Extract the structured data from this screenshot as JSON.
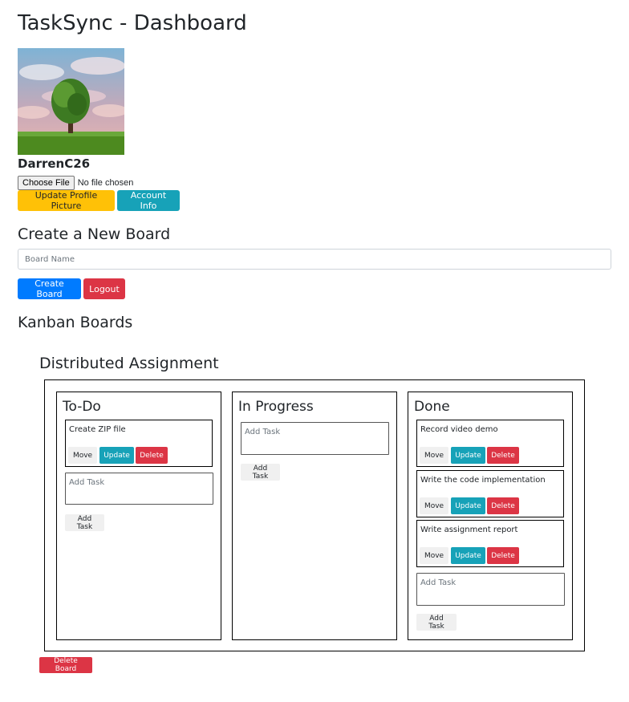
{
  "page_title": "TaskSync - Dashboard",
  "profile": {
    "username": "DarrenC26",
    "choose_file_label": "Choose File",
    "no_file_text": "No file chosen",
    "update_picture_label": "Update Profile Picture",
    "account_info_label": "Account Info"
  },
  "create_board": {
    "heading": "Create a New Board",
    "placeholder": "Board Name",
    "value": "",
    "create_label": "Create Board",
    "logout_label": "Logout"
  },
  "kanban": {
    "heading": "Kanban Boards",
    "board": {
      "title": "Distributed Assignment",
      "delete_label": "Delete Board",
      "columns": [
        {
          "title": "To-Do",
          "tasks": [
            "Create ZIP file"
          ],
          "add_placeholder": "Add Task",
          "add_label": "Add Task"
        },
        {
          "title": "In Progress",
          "tasks": [],
          "add_placeholder": "Add Task",
          "add_label": "Add Task"
        },
        {
          "title": "Done",
          "tasks": [
            "Record video demo",
            "Write the code implementation",
            "Write assignment report"
          ],
          "add_placeholder": "Add Task",
          "add_label": "Add Task"
        }
      ]
    }
  },
  "task_actions": {
    "move_label": "Move",
    "update_label": "Update",
    "delete_label": "Delete"
  },
  "colors": {
    "primary": "#007bff",
    "info": "#17a2b8",
    "warning": "#ffc107",
    "danger": "#dc3545",
    "light": "#f0f0f0"
  }
}
